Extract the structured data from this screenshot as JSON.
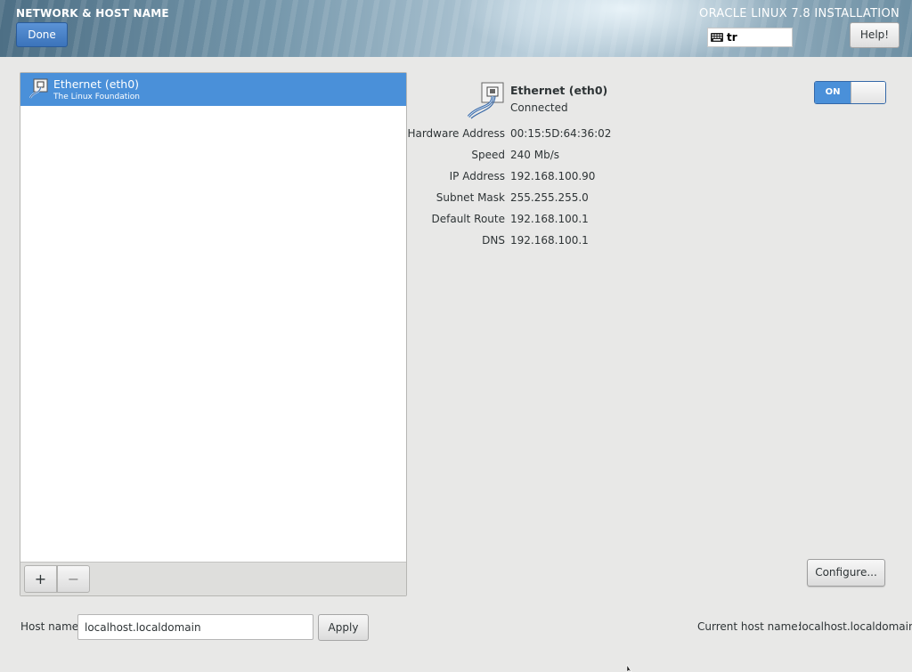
{
  "header": {
    "spoke_title": "NETWORK & HOST NAME",
    "done_label": "Done",
    "product_title": "ORACLE LINUX 7.8 INSTALLATION",
    "keyboard_layout": "tr",
    "help_label": "Help!"
  },
  "device_list": {
    "items": [
      {
        "name": "Ethernet (eth0)",
        "vendor": "The Linux Foundation",
        "selected": true
      }
    ],
    "add_label": "+",
    "remove_label": "−"
  },
  "device_detail": {
    "name": "Ethernet (eth0)",
    "status": "Connected",
    "switch_label": "ON",
    "switch_on": true,
    "info": [
      {
        "label": "Hardware Address",
        "value": "00:15:5D:64:36:02"
      },
      {
        "label": "Speed",
        "value": "240 Mb/s"
      },
      {
        "label": "IP Address",
        "value": "192.168.100.90"
      },
      {
        "label": "Subnet Mask",
        "value": "255.255.255.0"
      },
      {
        "label": "Default Route",
        "value": "192.168.100.1"
      },
      {
        "label": "DNS",
        "value": "192.168.100.1"
      }
    ],
    "configure_label": "Configure..."
  },
  "hostname": {
    "label": "Host name:",
    "value": "localhost.localdomain",
    "apply_label": "Apply",
    "current_label": "Current host name:",
    "current_value": "localhost.localdomain"
  },
  "colors": {
    "accent": "#4a90d9",
    "background": "#e8e8e7"
  }
}
